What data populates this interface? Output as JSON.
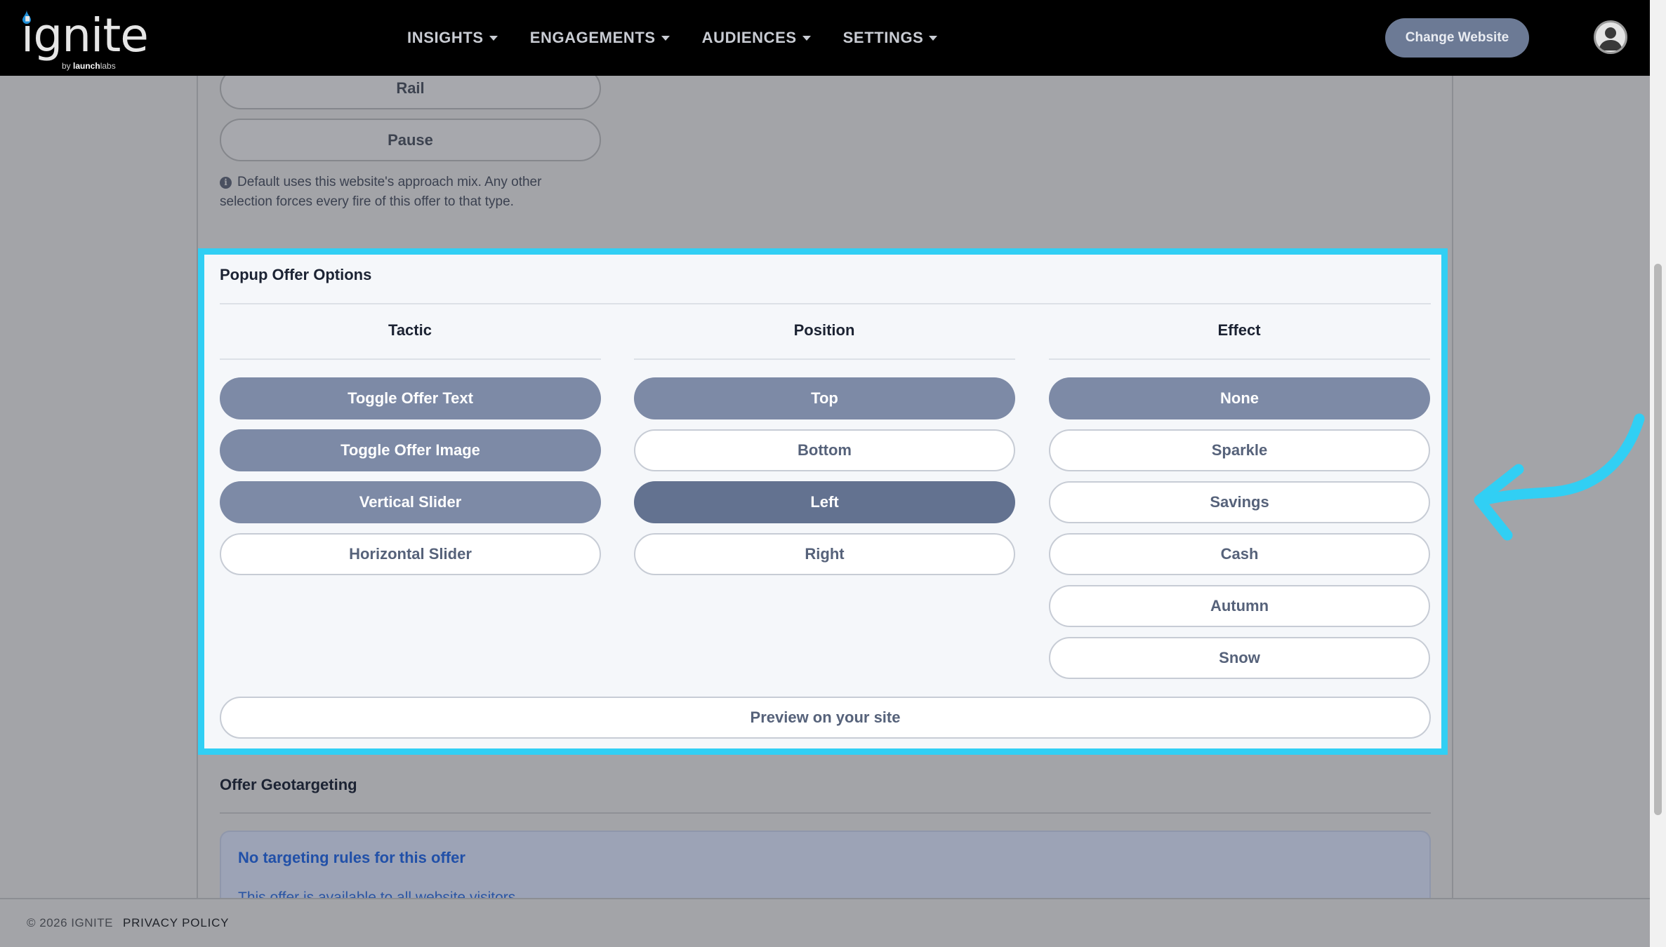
{
  "header": {
    "logo_text": "ignite",
    "logo_sub_prefix": "by ",
    "logo_sub_brand": "launch",
    "logo_sub_suffix": "labs",
    "nav": [
      {
        "label": "INSIGHTS"
      },
      {
        "label": "ENGAGEMENTS"
      },
      {
        "label": "AUDIENCES"
      },
      {
        "label": "SETTINGS"
      }
    ],
    "change_website_label": "Change Website"
  },
  "approach": {
    "options": [
      "Rail",
      "Pause"
    ],
    "note": "Default uses this website's approach mix. Any other selection forces every fire of this offer to that type."
  },
  "popup_options": {
    "title": "Popup Offer Options",
    "columns": {
      "tactic": {
        "header": "Tactic",
        "items": [
          {
            "label": "Toggle Offer Text",
            "state": "selected"
          },
          {
            "label": "Toggle Offer Image",
            "state": "selected"
          },
          {
            "label": "Vertical Slider",
            "state": "selected"
          },
          {
            "label": "Horizontal Slider",
            "state": "unselected"
          }
        ]
      },
      "position": {
        "header": "Position",
        "items": [
          {
            "label": "Top",
            "state": "selected"
          },
          {
            "label": "Bottom",
            "state": "unselected"
          },
          {
            "label": "Left",
            "state": "active"
          },
          {
            "label": "Right",
            "state": "unselected"
          }
        ]
      },
      "effect": {
        "header": "Effect",
        "items": [
          {
            "label": "None",
            "state": "selected"
          },
          {
            "label": "Sparkle",
            "state": "unselected"
          },
          {
            "label": "Savings",
            "state": "unselected"
          },
          {
            "label": "Cash",
            "state": "unselected"
          },
          {
            "label": "Autumn",
            "state": "unselected"
          },
          {
            "label": "Snow",
            "state": "unselected"
          }
        ]
      }
    },
    "preview_label": "Preview on your site"
  },
  "geotargeting": {
    "title": "Offer Geotargeting",
    "alert_title": "No targeting rules for this offer",
    "alert_text": "This offer is available to all website visitors."
  },
  "footer": {
    "copyright": "© 2026 IGNITE",
    "privacy_label": "PRIVACY POLICY"
  },
  "colors": {
    "highlight": "#31cff4",
    "selected_pill": "#7d8aa6",
    "active_pill": "#637290",
    "nav_background": "#000000"
  },
  "icons": [
    "info-icon",
    "user-avatar-icon",
    "caret-down-icon",
    "curved-arrow-icon",
    "droplet-icon"
  ]
}
